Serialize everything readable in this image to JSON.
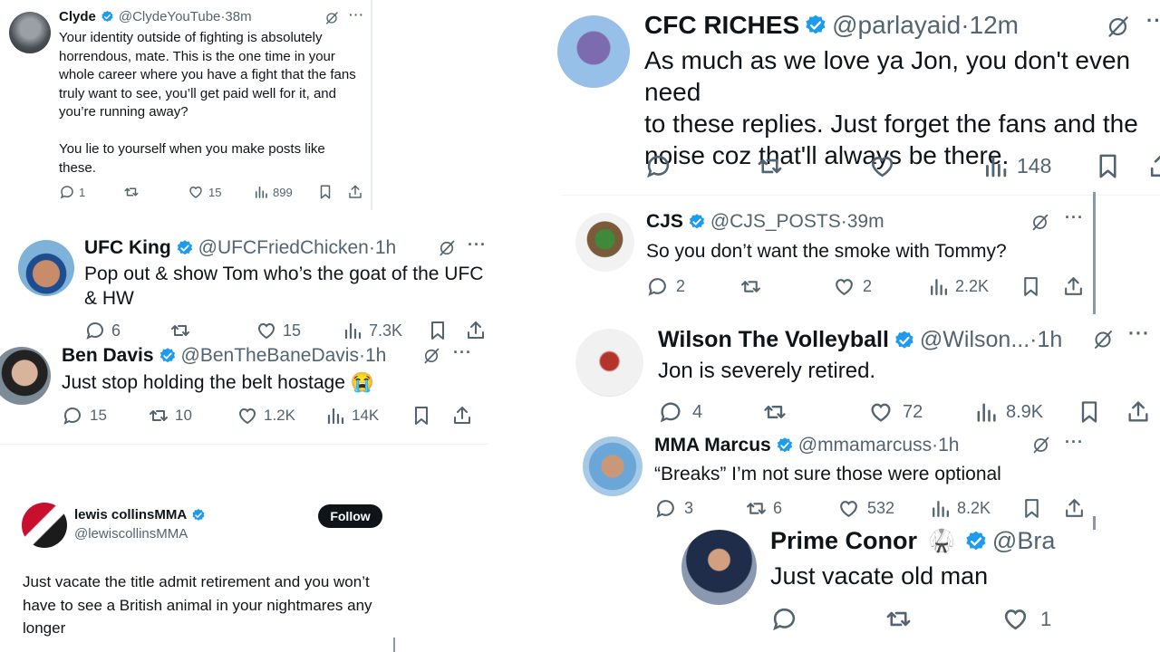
{
  "tweets": {
    "clyde": {
      "name": "Clyde",
      "handle": "@ClydeYouTube",
      "time": "38m",
      "text": "Your identity outside of fighting is absolutely horrendous, mate. This is the one time in your whole career where you have a fight that the fans truly want to see, you’ll get paid well for it, and you’re running away?\n\nYou lie to yourself when you make posts like these.",
      "replies": "1",
      "likes": "15",
      "views": "899"
    },
    "ufcking": {
      "name": "UFC King",
      "handle": "@UFCFriedChicken",
      "time": "1h",
      "text": "Pop out & show Tom who’s the goat of the UFC & HW",
      "replies": "6",
      "likes": "15",
      "views": "7.3K"
    },
    "bendavis": {
      "name": "Ben Davis",
      "handle": "@BenTheBaneDavis",
      "time": "1h",
      "text": "Just stop holding the belt hostage 😭",
      "replies": "15",
      "reposts": "10",
      "likes": "1.2K",
      "views": "14K"
    },
    "lewis": {
      "name": "lewis collinsMMA",
      "handle": "@lewiscollinsMMA",
      "follow": "Follow",
      "text": "Just vacate the title admit retirement and you won’t have to see a British animal in your nightmares any longer"
    },
    "cfc": {
      "name": "CFC RICHES",
      "handle": "@parlayaid",
      "time": "12m",
      "text": "As much as we love ya Jon, you don't even need\nto these replies. Just forget the fans and the\nnoise coz that'll always be there.",
      "views": "148"
    },
    "cjs": {
      "name": "CJS",
      "handle": "@CJS_POSTS",
      "time": "39m",
      "text": "So you don’t want the smoke with Tommy?",
      "replies": "2",
      "likes": "2",
      "views": "2.2K"
    },
    "wilson": {
      "name": "Wilson The Volleyball",
      "handle": "@Wilson...",
      "time": "1h",
      "text": "Jon is severely retired.",
      "replies": "4",
      "likes": "72",
      "views": "8.9K"
    },
    "marcus": {
      "name": "MMA Marcus",
      "handle": "@mmamarcuss",
      "time": "1h",
      "text": "“Breaks” I’m not sure those were optional",
      "replies": "3",
      "reposts": "6",
      "likes": "532",
      "views": "8.2K"
    },
    "conor": {
      "name": "Prime Conor",
      "handle": "@Bra",
      "emoji": "🥋",
      "text": "Just vacate old man",
      "likes": "1"
    }
  },
  "symbols": {
    "dot": "·",
    "more": "···"
  },
  "colors": {
    "verified": "#1d9bf0",
    "muted": "#536471",
    "text": "#0f1419"
  },
  "icons": [
    "verified-badge-icon",
    "reply-icon",
    "repost-icon",
    "like-icon",
    "views-icon",
    "bookmark-icon",
    "share-icon",
    "grok-icon",
    "more-icon"
  ]
}
